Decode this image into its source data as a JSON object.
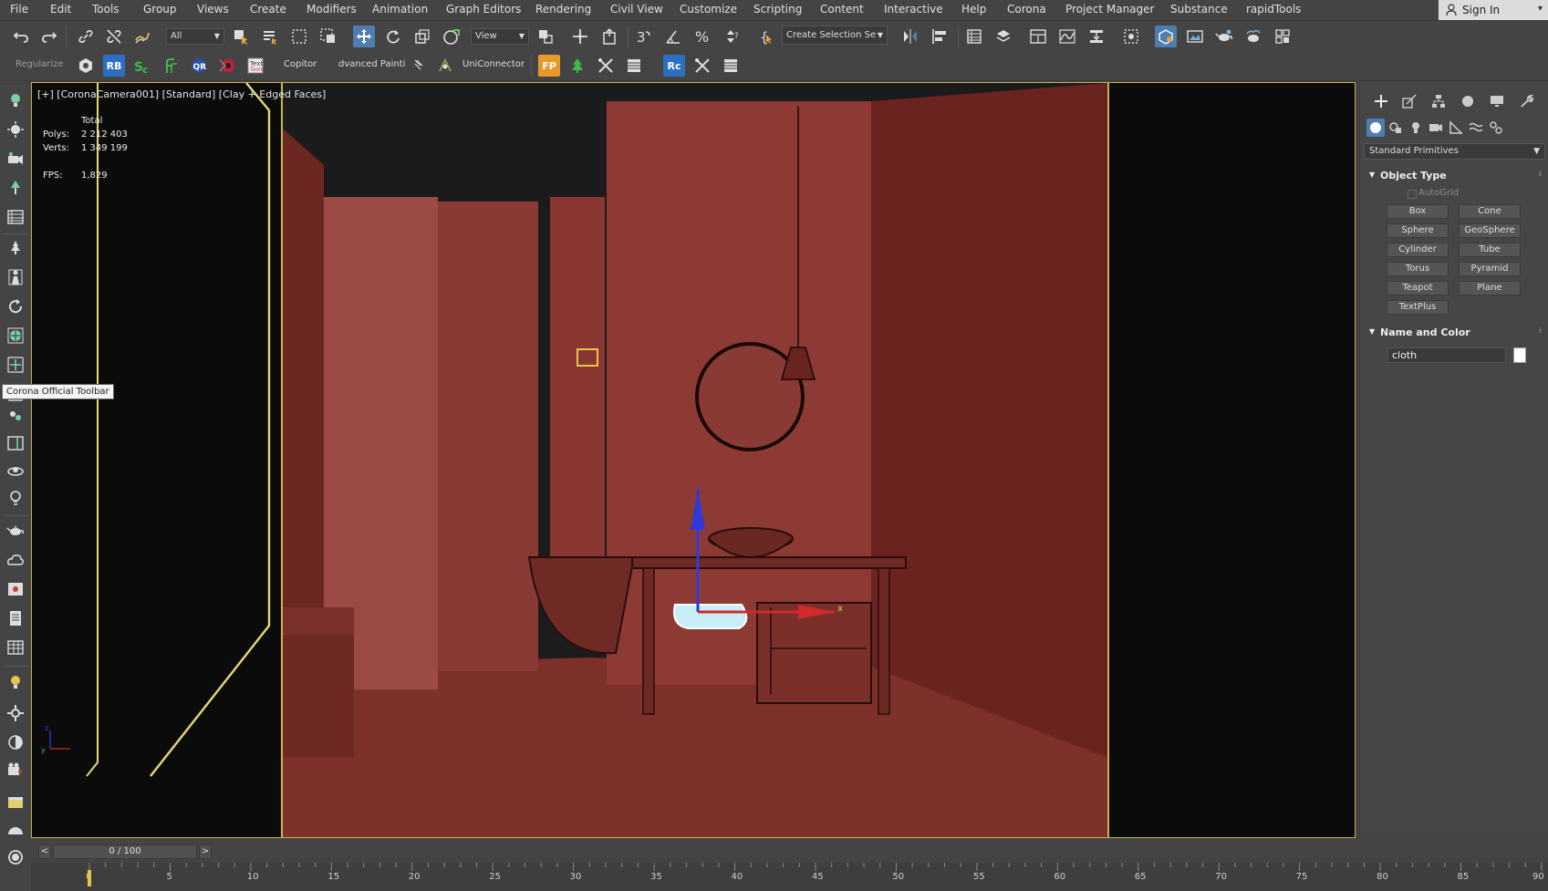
{
  "menu": {
    "items": [
      "File",
      "Edit",
      "Tools",
      "Group",
      "Views",
      "Create",
      "Modifiers",
      "Animation",
      "Graph Editors",
      "Rendering",
      "Civil View",
      "Customize",
      "Scripting",
      "Content",
      "Interactive",
      "Help",
      "Corona",
      "Project Manager",
      "Substance",
      "rapidTools"
    ],
    "sign_in": "Sign In"
  },
  "toolbar1": {
    "selection_filter": "All",
    "ref_coord": "View",
    "named_selection": "Create Selection Se"
  },
  "toolbar2": {
    "regularize": "Regularize",
    "rb": "RB",
    "copitor": "Copitor",
    "advanced_paint": "dvanced Painti",
    "uniconnector": "UniConnector",
    "fp": "FP",
    "rc": "Rc"
  },
  "tooltip": "Corona Official Toolbar",
  "viewport": {
    "label": "[+] [CoronaCamera001] [Standard] [Clay + Edged Faces]",
    "stats": {
      "total_label": "Total",
      "polys_label": "Polys:",
      "polys_value": "2 212 403",
      "verts_label": "Verts:",
      "verts_value": "1 349 199",
      "fps_label": "FPS:",
      "fps_value": "1,829"
    },
    "gizmo_x": "x",
    "gizmo_y": "y",
    "gizmo_z": "z"
  },
  "command_panel": {
    "category": "Standard Primitives",
    "object_type": {
      "title": "Object Type",
      "autogrid": "AutoGrid",
      "buttons": [
        "Box",
        "Cone",
        "Sphere",
        "GeoSphere",
        "Cylinder",
        "Tube",
        "Torus",
        "Pyramid",
        "Teapot",
        "Plane",
        "TextPlus"
      ]
    },
    "name_and_color": {
      "title": "Name and Color",
      "name": "cloth",
      "color": "#ffffff"
    }
  },
  "timeline": {
    "position": "0 / 100",
    "prev": "<",
    "next": ">",
    "frames": [
      "0",
      "5",
      "10",
      "15",
      "20",
      "25",
      "30",
      "35",
      "40",
      "45",
      "50",
      "55",
      "60",
      "65",
      "70",
      "75",
      "80",
      "85",
      "90"
    ]
  },
  "colors": {
    "ui_bg": "#444444",
    "active_blue": "#4e7db2",
    "viewport_border": "#c8b24a",
    "clay": "#8a3a34"
  }
}
